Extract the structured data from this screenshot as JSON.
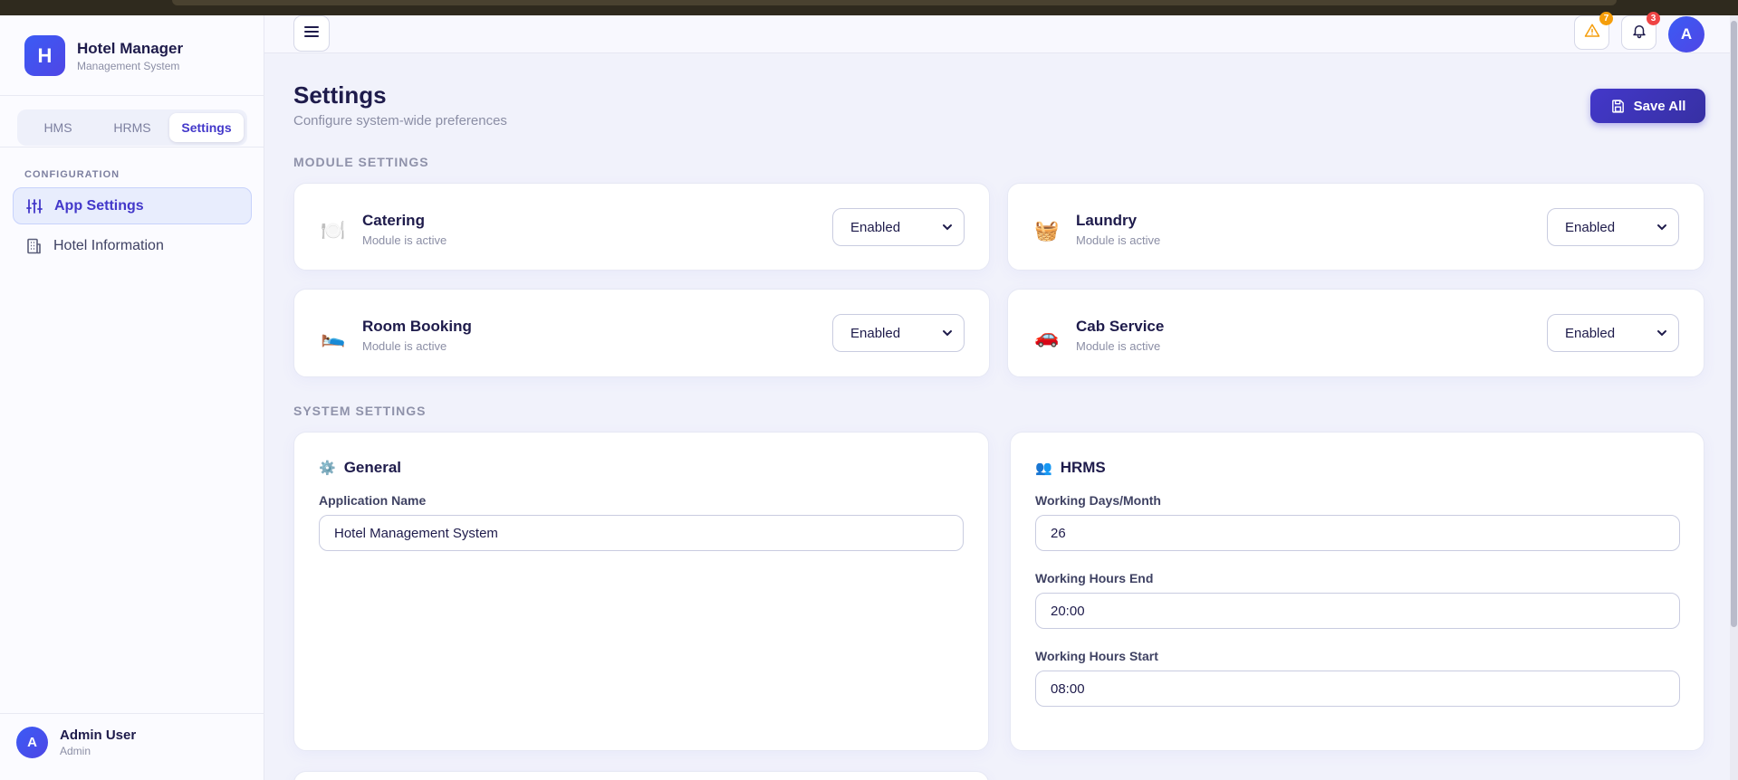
{
  "brand": {
    "logo_letter": "H",
    "title": "Hotel Manager",
    "subtitle": "Management System"
  },
  "segments": [
    {
      "label": "HMS",
      "active": false
    },
    {
      "label": "HRMS",
      "active": false
    },
    {
      "label": "Settings",
      "active": true
    }
  ],
  "sidebar": {
    "section_label": "CONFIGURATION",
    "items": [
      {
        "label": "App Settings",
        "icon": "sliders-icon",
        "active": true
      },
      {
        "label": "Hotel Information",
        "icon": "building-icon",
        "active": false
      }
    ]
  },
  "user": {
    "avatar_letter": "A",
    "name": "Admin User",
    "role": "Admin"
  },
  "topbar": {
    "alerts_badge": "7",
    "notifications_badge": "3",
    "avatar_letter": "A"
  },
  "header": {
    "title": "Settings",
    "subtitle": "Configure system-wide preferences",
    "save_label": "Save All"
  },
  "module_section_label": "MODULE SETTINGS",
  "modules": [
    {
      "name": "Catering",
      "status": "Module is active",
      "value": "Enabled",
      "icon": "🍽️"
    },
    {
      "name": "Laundry",
      "status": "Module is active",
      "value": "Enabled",
      "icon": "🧺"
    },
    {
      "name": "Room Booking",
      "status": "Module is active",
      "value": "Enabled",
      "icon": "🛌"
    },
    {
      "name": "Cab Service",
      "status": "Module is active",
      "value": "Enabled",
      "icon": "🚗"
    }
  ],
  "system_section_label": "SYSTEM SETTINGS",
  "general": {
    "icon": "⚙️",
    "title": "General",
    "app_name_label": "Application Name",
    "app_name_value": "Hotel Management System"
  },
  "hrms": {
    "icon": "👥",
    "title": "HRMS",
    "days_label": "Working Days/Month",
    "days_value": "26",
    "end_label": "Working Hours End",
    "end_value": "20:00",
    "start_label": "Working Hours Start",
    "start_value": "08:00"
  },
  "colors": {
    "accent": "#4338ca",
    "brand_gradient_start": "#3b5bf5",
    "alert_badge": "#f59e0b",
    "notif_badge": "#ef4444"
  }
}
